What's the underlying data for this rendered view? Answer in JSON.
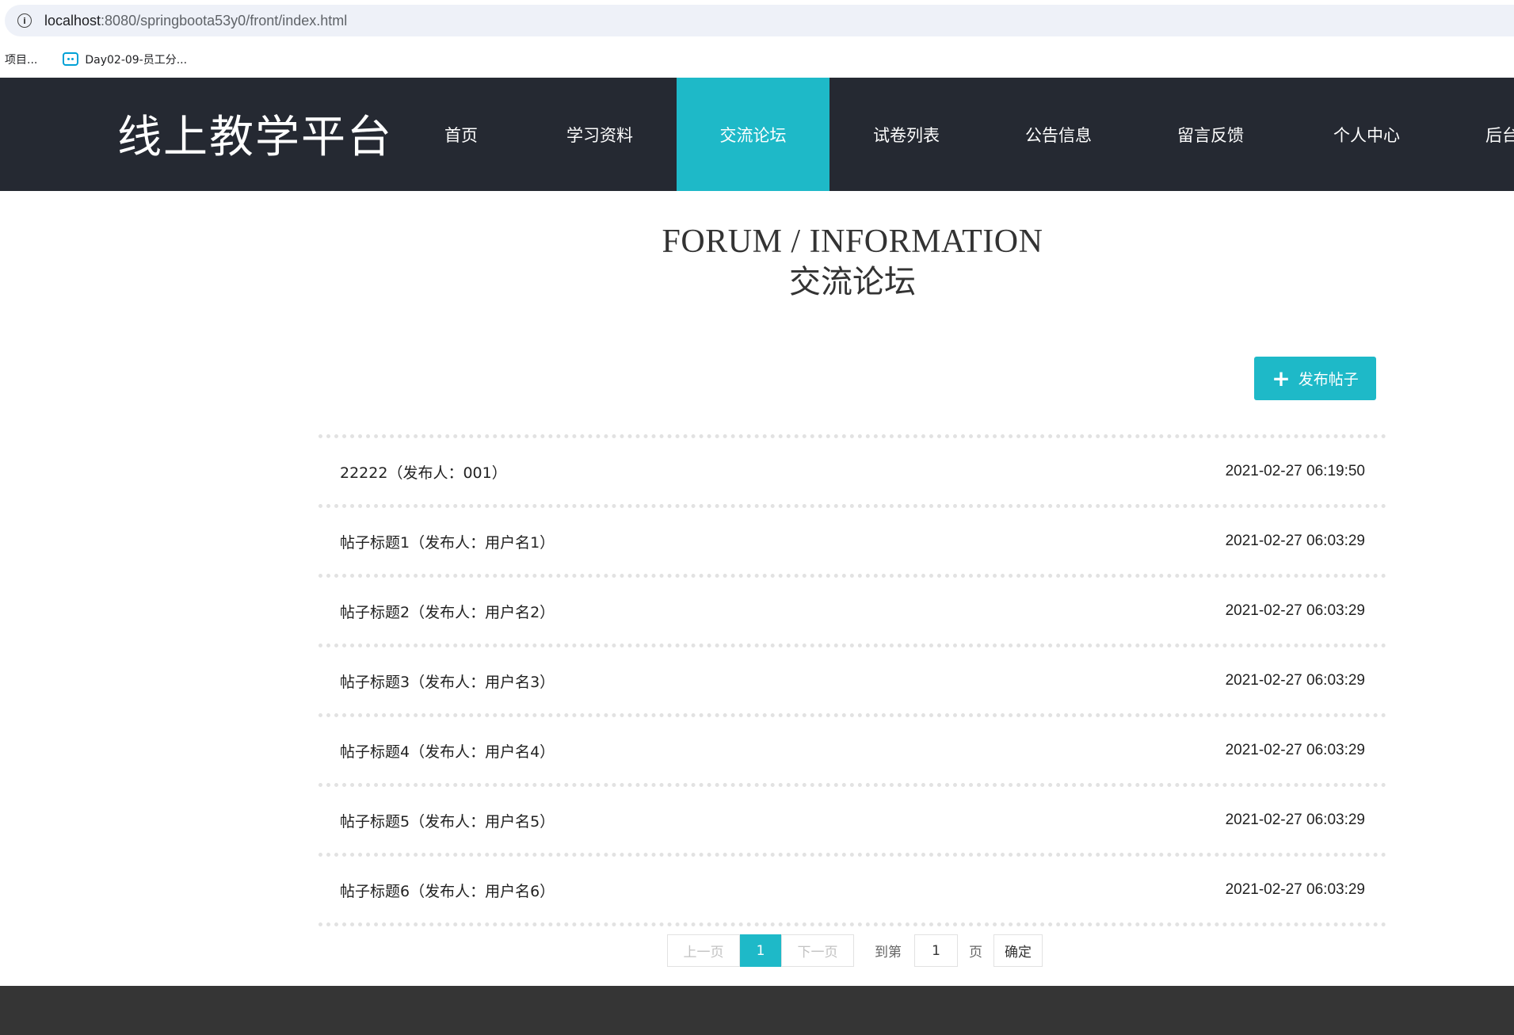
{
  "browser": {
    "url_host": "localhost",
    "url_path": ":8080/springboota53y0/front/index.html",
    "bookmarks": [
      {
        "label": "项目..."
      },
      {
        "label": "Day02-09-员工分..."
      }
    ]
  },
  "header": {
    "logo": "线上教学平台",
    "nav": [
      {
        "label": "首页"
      },
      {
        "label": "学习资料"
      },
      {
        "label": "交流论坛"
      },
      {
        "label": "试卷列表"
      },
      {
        "label": "公告信息"
      },
      {
        "label": "留言反馈"
      },
      {
        "label": "个人中心"
      },
      {
        "label": "后台"
      }
    ],
    "active_color": "#1eb9c8",
    "background": "#252932"
  },
  "section": {
    "title_en": "FORUM / INFORMATION",
    "title_cn": "交流论坛"
  },
  "actions": {
    "post_button_label": "发布帖子",
    "post_button_icon": "plus-icon"
  },
  "posts": [
    {
      "title": "22222（发布人：001）",
      "time": "2021-02-27 06:19:50"
    },
    {
      "title": "帖子标题1（发布人：用户名1）",
      "time": "2021-02-27 06:03:29"
    },
    {
      "title": "帖子标题2（发布人：用户名2）",
      "time": "2021-02-27 06:03:29"
    },
    {
      "title": "帖子标题3（发布人：用户名3）",
      "time": "2021-02-27 06:03:29"
    },
    {
      "title": "帖子标题4（发布人：用户名4）",
      "time": "2021-02-27 06:03:29"
    },
    {
      "title": "帖子标题5（发布人：用户名5）",
      "time": "2021-02-27 06:03:29"
    },
    {
      "title": "帖子标题6（发布人：用户名6）",
      "time": "2021-02-27 06:03:29"
    }
  ],
  "pagination": {
    "prev_label": "上一页",
    "current_page": "1",
    "next_label": "下一页",
    "goto_label": "到第",
    "goto_value": "1",
    "page_unit": "页",
    "confirm_label": "确定"
  }
}
